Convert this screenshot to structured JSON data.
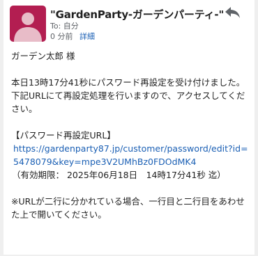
{
  "header": {
    "sender_name": "\"GardenParty-ガーデンパーティ-\"",
    "to_label": "To:",
    "to_value": "自分",
    "time": "0 分前",
    "details_link": "詳細",
    "avatar_color": "#b31e51"
  },
  "body": {
    "greeting": "ガーデン太郎 様",
    "paragraph1": "本日13時17分41秒にパスワード再設定を受け付けました。下記URLにて再設定処理を行いますので、アクセスしてください。",
    "section_title": "【パスワード再設定URL】",
    "reset_url": "https://gardenparty87.jp/customer/password/edit?id=5478079&key=mpe3V2UMhBz0FDOdMK4",
    "validity": "（有効期限： 2025年06月18日　14時17分41秒 迄）",
    "note": "※URLが二行に分かれている場合、一行目と二行目をあわせた上で開いてください。"
  },
  "icons": {
    "avatar": "person-icon",
    "reply": "reply-arrow-icon"
  },
  "colors": {
    "link": "#1a5fb4",
    "text": "#222222",
    "meta": "#5f6368"
  }
}
